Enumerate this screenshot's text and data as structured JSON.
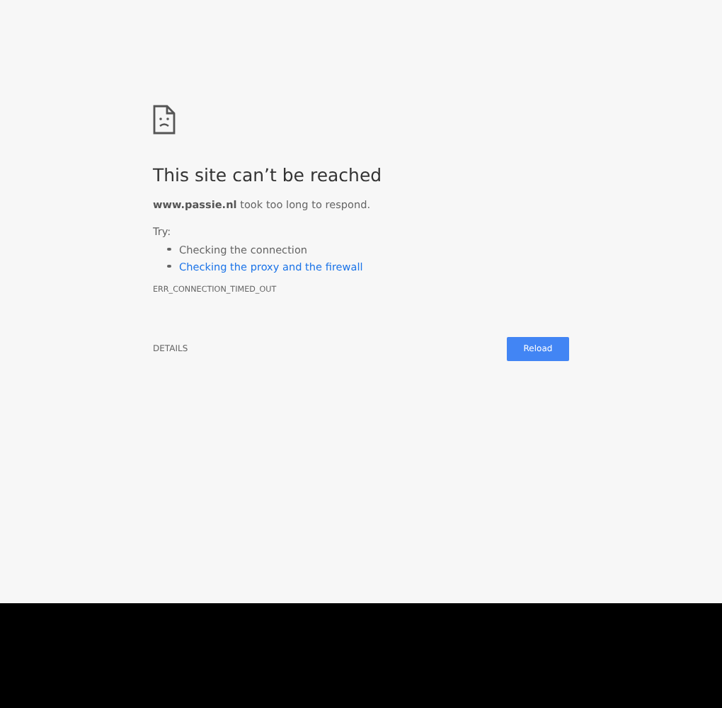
{
  "title": "This site can’t be reached",
  "message": {
    "host": "www.passie.nl",
    "text": "took too long to respond."
  },
  "try_label": "Try:",
  "suggestions": [
    {
      "kind": "text",
      "label": "Checking the connection"
    },
    {
      "kind": "link",
      "label": "Checking the proxy and the firewall"
    }
  ],
  "error_code": "ERR_CONNECTION_TIMED_OUT",
  "details_button": "DETAILS",
  "reload_button": "Reload"
}
